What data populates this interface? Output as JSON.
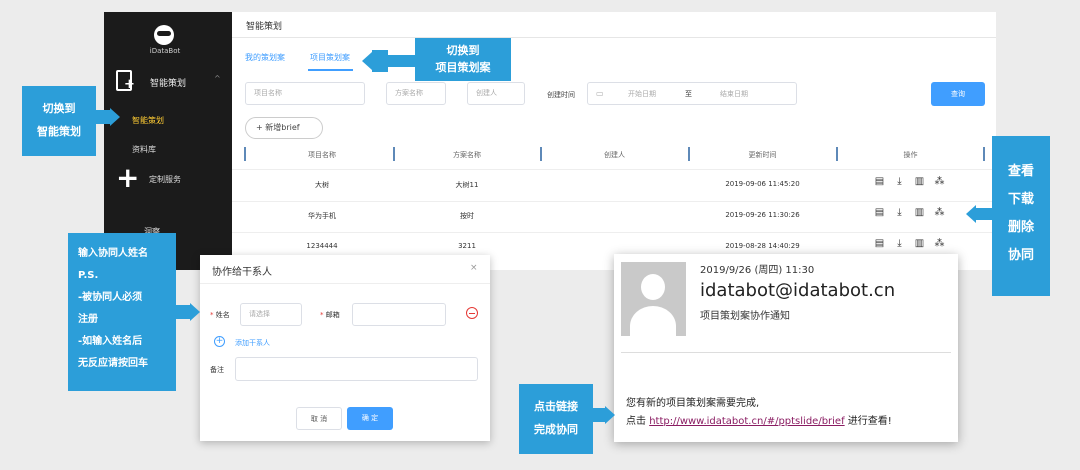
{
  "sidebar": {
    "logo_text": "iDataBot",
    "group_label": "智能策划",
    "group_caret": "^",
    "items": [
      "智能策划",
      "资料库",
      "定制服务",
      "洞察"
    ]
  },
  "main": {
    "page_title": "智能策划",
    "tabs": [
      "我的策划案",
      "项目策划案"
    ],
    "filters": {
      "project_name_placeholder": "项目名称",
      "plan_name_placeholder": "方案名称",
      "creator_placeholder": "创建人",
      "created_time_label": "创建时间",
      "start_date_placeholder": "开始日期",
      "range_separator": "至",
      "end_date_placeholder": "结束日期",
      "query_button": "查询"
    },
    "add_button": "+ 新增brief",
    "table": {
      "headers": [
        "项目名称",
        "方案名称",
        "创建人",
        "更新时间",
        "操作"
      ],
      "rows": [
        {
          "project": "大树",
          "plan": "大树11",
          "creator": "",
          "updated": "2019-09-06 11:45:20"
        },
        {
          "project": "华为手机",
          "plan": "按时",
          "creator": "",
          "updated": "2019-09-26 11:30:26"
        },
        {
          "project": "1234444",
          "plan": "3211",
          "creator": "",
          "updated": "2019-08-28 14:40:29"
        }
      ],
      "op_icons": [
        "view-icon",
        "download-icon",
        "delete-icon",
        "collaborate-icon"
      ]
    }
  },
  "callouts": {
    "switch_project": "切换到\n项目策划案",
    "switch_smart": "切换到\n智能策划",
    "actions": "查看\n下载\n删除\n协同",
    "collaborator_hint": "输入协同人姓名\nP.S.\n-被协同人必须\n注册\n-如输入姓名后\n无反应请按回车",
    "click_link": "点击链接\n完成协同"
  },
  "dialog": {
    "title": "协作给干系人",
    "close": "×",
    "name_label": "姓名",
    "name_placeholder": "请选择",
    "email_label": "邮箱",
    "add_contact": "添加干系人",
    "remark_label": "备注",
    "cancel_button": "取 消",
    "confirm_button": "确 定"
  },
  "email": {
    "date": "2019/9/26 (周四) 11:30",
    "from": "idatabot@idatabot.cn",
    "subject": "项目策划案协作通知",
    "body_line1": "您有新的项目策划案需要完成,",
    "body_prefix": "点击 ",
    "link": "http://www.idatabot.cn/#/pptslide/brief",
    "body_suffix": " 进行查看!"
  },
  "colors": {
    "accent": "#409eff",
    "callout": "#2c9ed9",
    "sidebar_bg": "#1b1b1b",
    "sidebar_active": "#ffcc33",
    "danger": "#e53935"
  }
}
